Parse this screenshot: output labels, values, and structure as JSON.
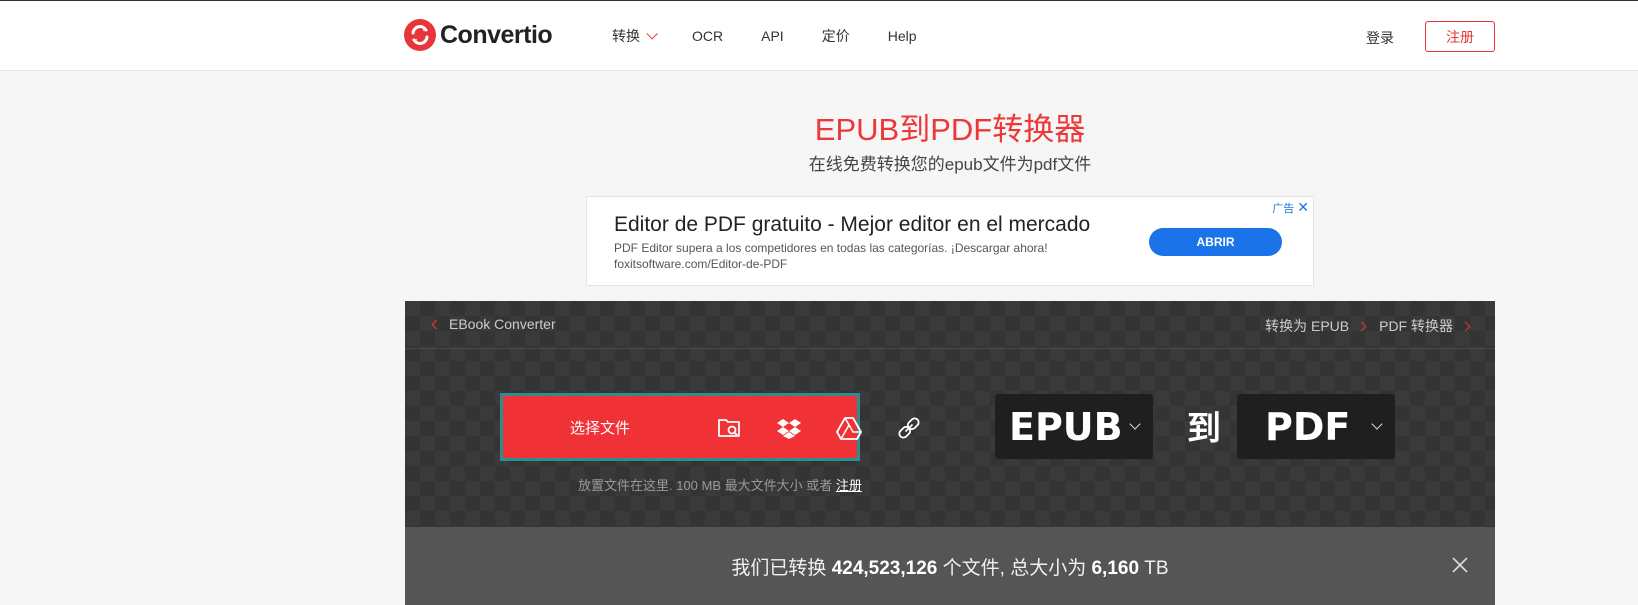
{
  "header": {
    "logo_text": "Convertio",
    "nav": [
      {
        "label": "转换",
        "has_dropdown": true
      },
      {
        "label": "OCR"
      },
      {
        "label": "API"
      },
      {
        "label": "定价"
      },
      {
        "label": "Help"
      }
    ],
    "login_label": "登录",
    "signup_label": "注册"
  },
  "hero": {
    "title": "EPUB到PDF转换器",
    "subtitle": "在线免费转换您的epub文件为pdf文件"
  },
  "ad": {
    "title": "Editor de PDF gratuito - Mejor editor en el mercado",
    "description": "PDF Editor supera a los competidores en todas las categorías. ¡Descargar ahora!",
    "url": "foxitsoftware.com/Editor-de-PDF",
    "button_label": "ABRIR",
    "badge_label": "广告"
  },
  "converter": {
    "breadcrumb_left": "EBook Converter",
    "breadcrumb_right": [
      {
        "label": "转换为 EPUB"
      },
      {
        "label": "PDF 转换器"
      }
    ],
    "upload_label": "选择文件",
    "upload_icons": [
      "folder-search-icon",
      "dropbox-icon",
      "google-drive-icon",
      "link-icon"
    ],
    "hint_text": "放置文件在这里. 100 MB 最大文件大小 或者 ",
    "hint_link": "注册",
    "from_format": "EPUB",
    "to_word": "到",
    "to_format": "PDF"
  },
  "stats": {
    "prefix": "我们已转换 ",
    "files_count": "424,523,126",
    "middle": " 个文件, 总大小为 ",
    "total_size": "6,160",
    "suffix": " TB"
  },
  "colors": {
    "brand_red": "#e8353a",
    "ad_blue": "#1a73e8",
    "upload_border": "#2b8e91"
  }
}
